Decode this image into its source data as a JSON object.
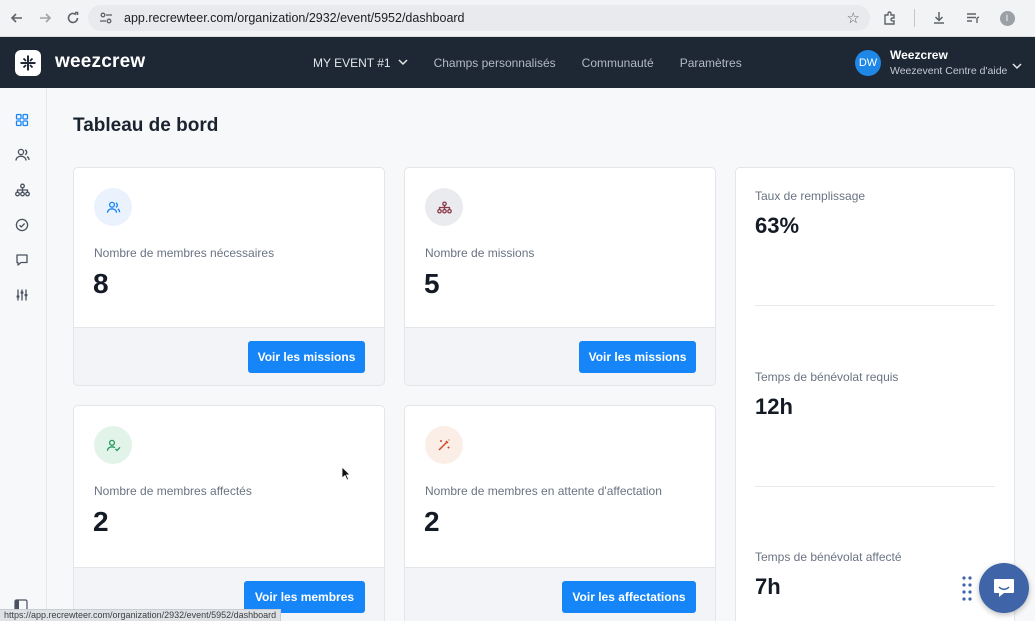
{
  "browser": {
    "url": "app.recrewteer.com/organization/2932/event/5952/dashboard",
    "status_url": "https://app.recrewteer.com/organization/2932/event/5952/dashboard",
    "profile_initial": "I"
  },
  "header": {
    "logo_text": "weezcrew",
    "nav": {
      "event": "MY EVENT #1",
      "custom_fields": "Champs personnalisés",
      "community": "Communauté",
      "settings": "Paramètres"
    },
    "user": {
      "initials": "DW",
      "name": "Weezcrew",
      "subtitle": "Weezevent Centre d'aide"
    }
  },
  "page": {
    "title": "Tableau de bord"
  },
  "cards": {
    "members_needed": {
      "label": "Nombre de membres nécessaires",
      "value": "8",
      "button": "Voir les missions",
      "icon": "users-icon"
    },
    "missions": {
      "label": "Nombre de missions",
      "value": "5",
      "button": "Voir les missions",
      "icon": "hierarchy-icon"
    },
    "members_assigned": {
      "label": "Nombre de membres affectés",
      "value": "2",
      "button": "Voir les membres",
      "icon": "user-check-icon"
    },
    "members_pending": {
      "label": "Nombre de membres en attente d'affectation",
      "value": "2",
      "button": "Voir les affectations",
      "icon": "magic-wand-icon"
    }
  },
  "stats": {
    "fill_rate": {
      "label": "Taux de remplissage",
      "value": "63%"
    },
    "volunteer_time_required": {
      "label": "Temps de bénévolat requis",
      "value": "12h"
    },
    "volunteer_time_assigned": {
      "label": "Temps de bénévolat affecté",
      "value": "7h"
    }
  },
  "colors": {
    "header_bg": "#1e2734",
    "primary_button": "#1685f8",
    "avatar": "#1f87e5",
    "chat_fab": "#3f64a8"
  }
}
